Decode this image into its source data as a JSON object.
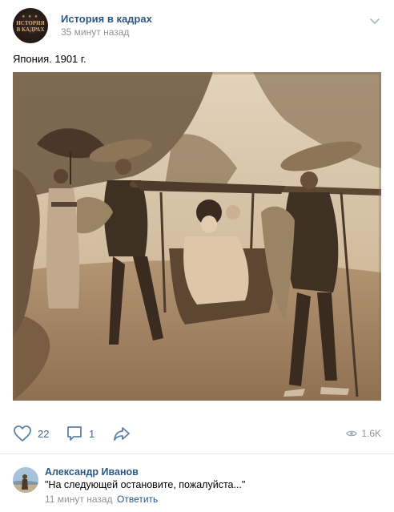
{
  "group": {
    "name": "История в кадрах",
    "time": "35 минут назад",
    "avatar_text_line1": "ИСТОРИЯ",
    "avatar_text_line2": "В КАДРАХ",
    "avatar_icon": "group-logo"
  },
  "post": {
    "text": "Япония. 1901 г.",
    "photo_icon": "sepia-photo-kago-palanquin"
  },
  "actions": {
    "likes": "22",
    "comments": "1",
    "views": "1.6K",
    "like_icon": "heart-icon",
    "comment_icon": "comment-icon",
    "share_icon": "share-arrow-icon",
    "views_icon": "eye-icon",
    "more_icon": "chevron-down-icon"
  },
  "comment": {
    "author": "Александр Иванов",
    "text": "\"На следующей остановите, пожалуйста...\"",
    "time": "11 минут назад",
    "reply_label": "Ответить"
  },
  "colors": {
    "link": "#2a5885",
    "muted": "#939393",
    "action": "#45678f",
    "divider": "#e7e8ec"
  }
}
